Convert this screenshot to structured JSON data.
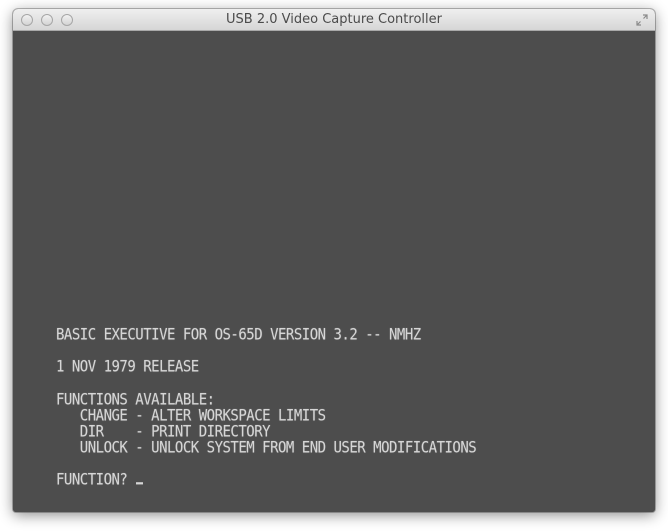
{
  "window": {
    "title": "USB 2.0 Video Capture Controller"
  },
  "terminal": {
    "lines": [
      "BASIC EXECUTIVE FOR OS-65D VERSION 3.2 -- NMHZ",
      "1 NOV 1979 RELEASE",
      "FUNCTIONS AVAILABLE:",
      "   CHANGE - ALTER WORKSPACE LIMITS",
      "   DIR    - PRINT DIRECTORY",
      "   UNLOCK - UNLOCK SYSTEM FROM END USER MODIFICATIONS",
      "FUNCTION? "
    ]
  },
  "colors": {
    "screen_background": "#4d4d4d",
    "terminal_text": "#d6d6d6"
  }
}
